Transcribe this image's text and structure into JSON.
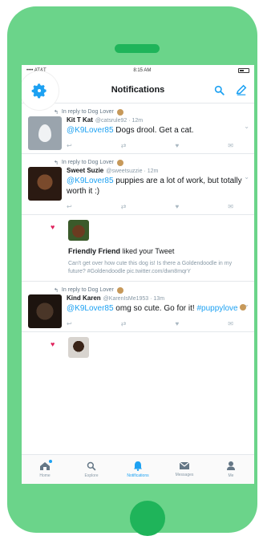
{
  "status_bar": {
    "carrier": "•••• AT&T",
    "time": "8:15 AM"
  },
  "nav": {
    "title": "Notifications"
  },
  "tweets": [
    {
      "reply_to": "In reply to Dog Lover",
      "name": "Kit T Kat",
      "handle": "@catsrule92 · 12m",
      "mention": "@K9Lover85",
      "text": " Dogs drool. Get a cat."
    },
    {
      "reply_to": "In reply to Dog Lover",
      "name": "Sweet Suzie",
      "handle": "@sweetsuzzie · 12m",
      "mention": "@K9Lover85",
      "text": " puppies are a lot of work, but totally worth it :)"
    },
    {
      "reply_to": "In reply to Dog Lover",
      "name": "Kind Karen",
      "handle": "@KarenIsMe1953 · 13m",
      "mention": "@K9Lover85",
      "text": " omg so cute. Go for it!",
      "hashtag": "#puppylove"
    }
  ],
  "like_notification": {
    "name": "Friendly Friend",
    "action": " liked your Tweet",
    "quote": "Can't get over how cute this dog is! Is there a Goldendoodle in my future? #Goldendoodle pic.twitter.com/dwn8mqrY"
  },
  "tabs": [
    {
      "label": "Home",
      "icon": "home-icon"
    },
    {
      "label": "Explore",
      "icon": "search-icon"
    },
    {
      "label": "Notifications",
      "icon": "bell-icon"
    },
    {
      "label": "Messages",
      "icon": "envelope-icon"
    },
    {
      "label": "Me",
      "icon": "person-icon"
    }
  ],
  "colors": {
    "accent": "#1da1f2",
    "phone": "#6bd48a",
    "phone_dark": "#1fb45a",
    "heart": "#e0245e"
  }
}
